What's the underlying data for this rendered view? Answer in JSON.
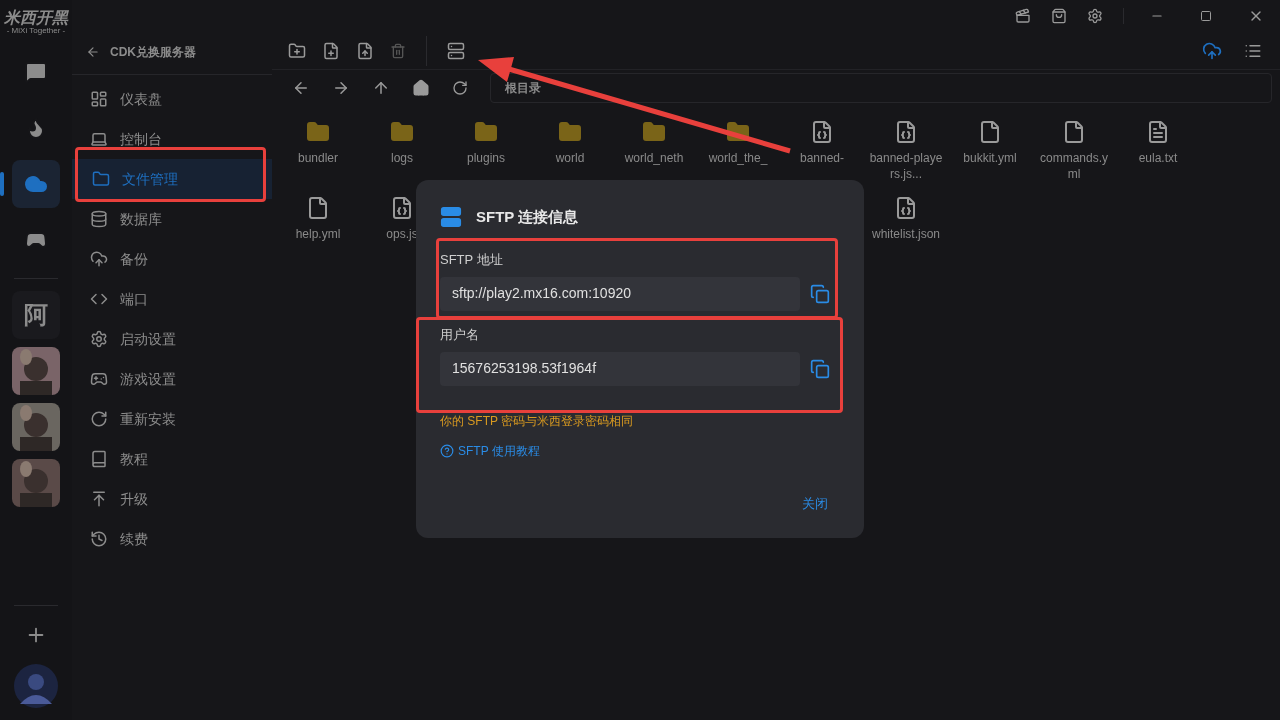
{
  "app": {
    "logo": "米西开黑",
    "logo_tagline": "- MiXi Together -"
  },
  "rail": {
    "items": [
      {
        "kind": "chat",
        "selected": false
      },
      {
        "kind": "fire",
        "selected": false
      },
      {
        "kind": "cloud",
        "selected": true
      },
      {
        "kind": "gamepad",
        "selected": false
      }
    ],
    "servers": [
      {
        "kind": "text",
        "label": "阿"
      },
      {
        "kind": "picture"
      },
      {
        "kind": "picture"
      },
      {
        "kind": "picture"
      }
    ]
  },
  "sidebar": {
    "back_label": "CDK兑换服务器",
    "items": [
      {
        "label": "仪表盘",
        "selected": false
      },
      {
        "label": "控制台",
        "selected": false
      },
      {
        "label": "文件管理",
        "selected": true
      },
      {
        "label": "数据库",
        "selected": false
      },
      {
        "label": "备份",
        "selected": false
      },
      {
        "label": "端口",
        "selected": false
      },
      {
        "label": "启动设置",
        "selected": false
      },
      {
        "label": "游戏设置",
        "selected": false
      },
      {
        "label": "重新安装",
        "selected": false
      },
      {
        "label": "教程",
        "selected": false
      },
      {
        "label": "升级",
        "selected": false
      },
      {
        "label": "续费",
        "selected": false
      }
    ]
  },
  "path_bar": {
    "path": "根目录"
  },
  "files": [
    [
      {
        "kind": "folder",
        "name": "bundler"
      },
      {
        "kind": "folder",
        "name": "logs"
      },
      {
        "kind": "folder",
        "name": "plugins"
      },
      {
        "kind": "folder",
        "name": "world"
      },
      {
        "kind": "folder",
        "name": "world_neth"
      },
      {
        "kind": "folder",
        "name": "world_the_"
      },
      {
        "kind": "json",
        "name": "banned-"
      },
      {
        "kind": "json",
        "name": "banned-players.js..."
      },
      {
        "kind": "yml",
        "name": "bukkit.yml"
      },
      {
        "kind": "yml",
        "name": "commands.yml"
      },
      {
        "kind": "txt",
        "name": "eula.txt"
      }
    ],
    [
      {
        "kind": "yml",
        "name": "help.yml"
      },
      {
        "kind": "json",
        "name": "ops.js"
      },
      {
        "kind": "json",
        "name": "whitelist.json"
      }
    ]
  ],
  "dialog": {
    "title": "SFTP 连接信息",
    "fields": [
      {
        "label": "SFTP 地址",
        "value": "sftp://play2.mx16.com:10920"
      },
      {
        "label": "用户名",
        "value": "15676253198.53f1964f"
      }
    ],
    "note": "你的 SFTP 密码与米西登录密码相同",
    "help_link": "SFTP 使用教程",
    "close_button": "关闭"
  }
}
